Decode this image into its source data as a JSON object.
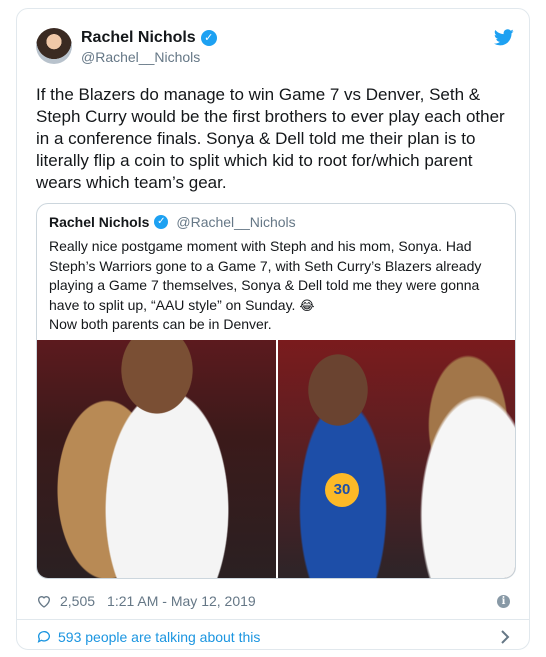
{
  "tweet": {
    "author": {
      "display_name": "Rachel Nichols",
      "handle": "@Rachel__Nichols",
      "verified_icon": "verified-badge-icon"
    },
    "text": "If the Blazers do manage to win Game 7 vs Denver, Seth & Steph Curry would be the first brothers to ever play each other in a conference finals. Sonya & Dell told me their plan is to literally flip a coin to split which kid to root for/which parent wears which team’s gear.",
    "quoted": {
      "display_name": "Rachel Nichols",
      "handle": "@Rachel__Nichols",
      "text_main": "Really nice postgame moment with Steph and his mom, Sonya. Had Steph’s Warriors gone to a Game 7, with Seth Curry’s Blazers already playing a Game 7 themselves, Sonya & Dell told me they were gonna have to split up, “AAU style” on Sunday.",
      "emoji": "😂",
      "text_line2": "Now both parents can be in Denver.",
      "jersey_number": "30"
    },
    "likes": "2,505",
    "timestamp": "1:21 AM - May 12, 2019",
    "talking": "593 people are talking about this"
  },
  "colors": {
    "accent": "#1da1f2",
    "link": "#1b95e0",
    "muted": "#657786",
    "border": "#e1e8ed"
  }
}
